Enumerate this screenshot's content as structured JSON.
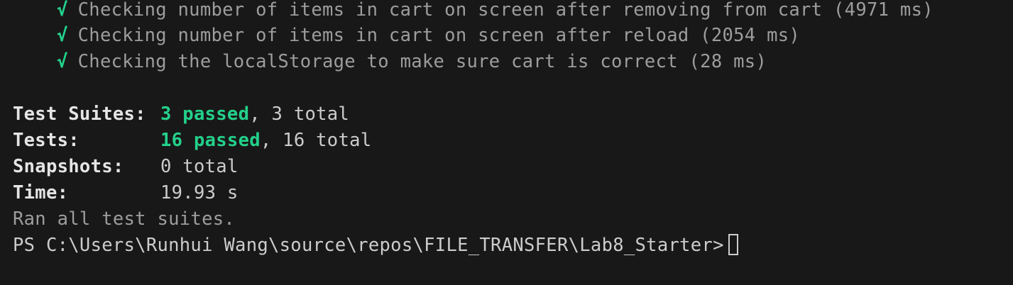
{
  "checks": [
    {
      "mark": "√",
      "text": "Checking number of items in cart on screen after removing from cart (4971 ms)"
    },
    {
      "mark": "√",
      "text": "Checking number of items in cart on screen after reload (2054 ms)"
    },
    {
      "mark": "√",
      "text": "Checking the localStorage to make sure cart is correct (28 ms)"
    }
  ],
  "summary": {
    "suites": {
      "label": "Test Suites:",
      "passed": "3 passed",
      "rest": ", 3 total"
    },
    "tests": {
      "label": "Tests:",
      "passed": "16 passed",
      "rest": ", 16 total"
    },
    "snapshots": {
      "label": "Snapshots:",
      "value": "0 total"
    },
    "time": {
      "label": "Time:",
      "value": "19.93 s"
    },
    "ran": "Ran all test suites."
  },
  "prompt": {
    "text": "PS C:\\Users\\Runhui Wang\\source\\repos\\FILE_TRANSFER\\Lab8_Starter>"
  },
  "colors": {
    "background": "#181818",
    "pass": "#23d18b",
    "text": "#cccccc",
    "dim": "#9d9d9d"
  }
}
